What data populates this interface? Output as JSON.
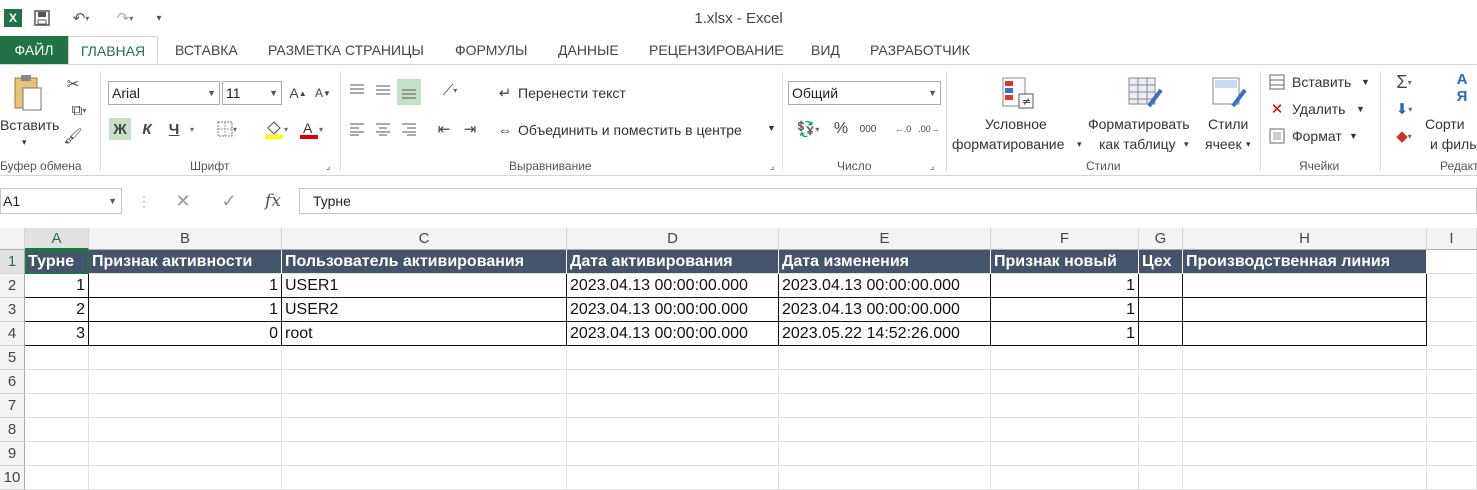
{
  "window": {
    "title": "1.xlsx - Excel"
  },
  "tabs": [
    "ФАЙЛ",
    "ГЛАВНАЯ",
    "ВСТАВКА",
    "РАЗМЕТКА СТРАНИЦЫ",
    "ФОРМУЛЫ",
    "ДАННЫЕ",
    "РЕЦЕНЗИРОВАНИЕ",
    "ВИД",
    "РАЗРАБОТЧИК"
  ],
  "ribbon": {
    "clipboard": {
      "paste": "Вставить",
      "group": "Буфер обмена"
    },
    "font": {
      "name": "Arial",
      "size": "11",
      "bold": "Ж",
      "italic": "К",
      "underline": "Ч",
      "group": "Шрифт"
    },
    "alignment": {
      "wrap": "Перенести текст",
      "merge": "Объединить и поместить в центре",
      "group": "Выравнивание"
    },
    "number": {
      "format": "Общий",
      "percent": "%",
      "thousands": "000",
      "group": "Число"
    },
    "styles": {
      "conditional_1": "Условное",
      "conditional_2": "форматирование",
      "table_1": "Форматировать",
      "table_2": "как таблицу",
      "cell_1": "Стили",
      "cell_2": "ячеек",
      "group": "Стили"
    },
    "cells": {
      "insert": "Вставить",
      "delete": "Удалить",
      "format": "Формат",
      "group": "Ячейки"
    },
    "editing": {
      "sort_1": "Сорти",
      "sort_2": "и филь",
      "group": "Редакт"
    }
  },
  "formula_bar": {
    "name_box": "A1",
    "value": "Турне"
  },
  "columns": [
    "A",
    "B",
    "C",
    "D",
    "E",
    "F",
    "G",
    "H",
    "I"
  ],
  "rows": [
    "1",
    "2",
    "3",
    "4",
    "5",
    "6",
    "7",
    "8",
    "9",
    "10"
  ],
  "table": {
    "headers": [
      "Турне",
      "Признак активности",
      "Пользователь активирования",
      "Дата активирования",
      "Дата изменения",
      "Признак новый",
      "Цех",
      "Производственная линия"
    ],
    "rows": [
      [
        "1",
        "1",
        "USER1",
        "2023.04.13 00:00:00.000",
        "2023.04.13 00:00:00.000",
        "1",
        "",
        ""
      ],
      [
        "2",
        "1",
        "USER2",
        "2023.04.13 00:00:00.000",
        "2023.04.13 00:00:00.000",
        "1",
        "",
        ""
      ],
      [
        "3",
        "0",
        "root",
        "2023.04.13 00:00:00.000",
        "2023.05.22 14:52:26.000",
        "1",
        "",
        ""
      ]
    ]
  }
}
